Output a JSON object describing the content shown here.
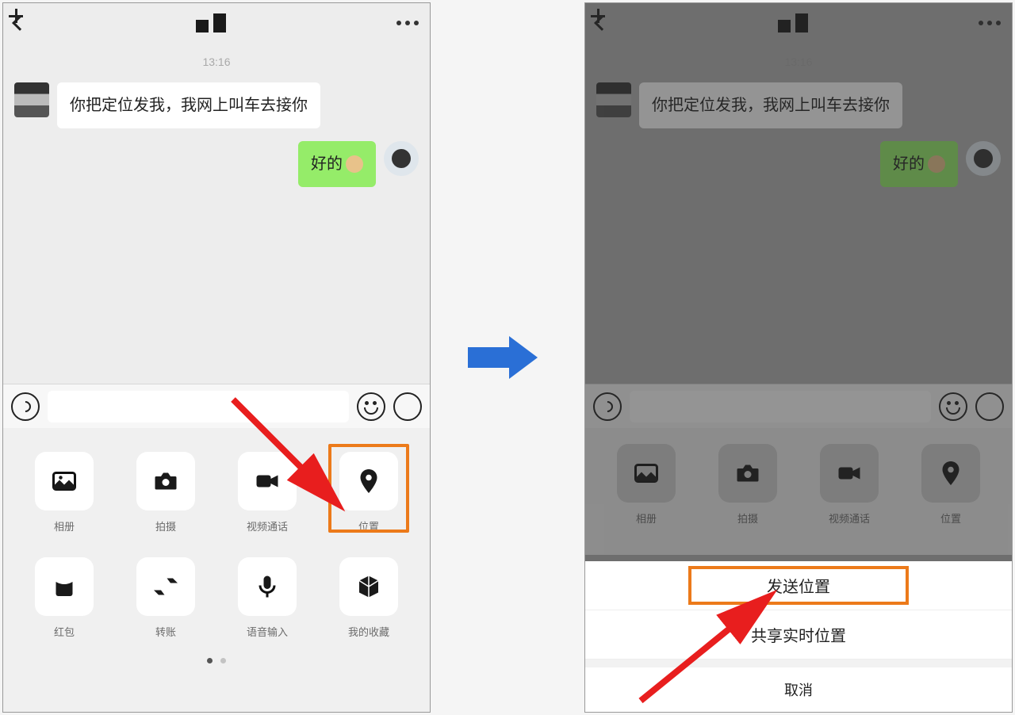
{
  "chat": {
    "timestamp": "13:16",
    "msg_incoming": "你把定位发我，我网上叫车去接你",
    "msg_outgoing": "好的",
    "emoji": "👌"
  },
  "attachments": [
    {
      "key": "album",
      "label": "相册",
      "icon": "image"
    },
    {
      "key": "camera",
      "label": "拍摄",
      "icon": "camera"
    },
    {
      "key": "video",
      "label": "视频通话",
      "icon": "video"
    },
    {
      "key": "location",
      "label": "位置",
      "icon": "pin",
      "highlighted": true
    },
    {
      "key": "hongbao",
      "label": "红包",
      "icon": "envelope"
    },
    {
      "key": "transfer",
      "label": "转账",
      "icon": "swap"
    },
    {
      "key": "voice",
      "label": "语音输入",
      "icon": "mic"
    },
    {
      "key": "favorite",
      "label": "我的收藏",
      "icon": "cube"
    }
  ],
  "sheet": {
    "option_send_location": "发送位置",
    "option_share_realtime": "共享实时位置",
    "cancel": "取消"
  }
}
